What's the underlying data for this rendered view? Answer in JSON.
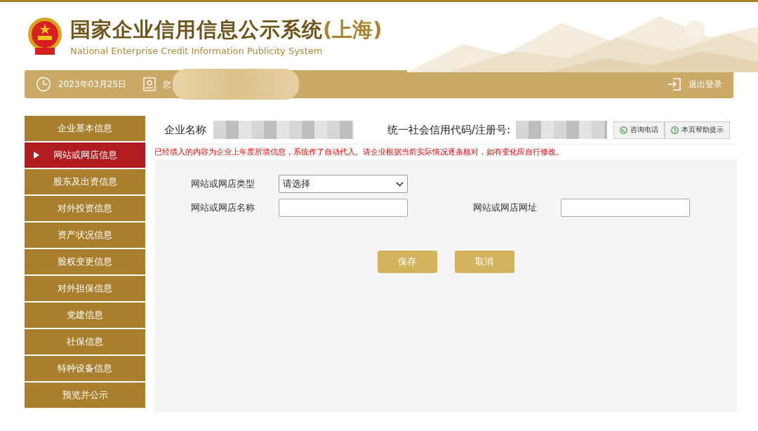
{
  "header": {
    "title": "国家企业信用信息公示系统",
    "region": "(上海)",
    "subtitle": "National Enterprise Credit Information Publicity System"
  },
  "top_bar": {
    "date": "2023年03月25日",
    "greeting": "您",
    "logout": "退出登录"
  },
  "sidebar": {
    "items": [
      {
        "label": "企业基本信息",
        "selected": false
      },
      {
        "label": "网站或网店信息",
        "selected": true
      },
      {
        "label": "股东及出资信息",
        "selected": false
      },
      {
        "label": "对外投资信息",
        "selected": false
      },
      {
        "label": "资产状况信息",
        "selected": false
      },
      {
        "label": "股权变更信息",
        "selected": false
      },
      {
        "label": "对外担保信息",
        "selected": false
      },
      {
        "label": "党建信息",
        "selected": false
      },
      {
        "label": "社保信息",
        "selected": false
      },
      {
        "label": "特种设备信息",
        "selected": false
      },
      {
        "label": "预览并公示",
        "selected": false
      }
    ]
  },
  "company": {
    "name_label": "企业名称",
    "code_label": "统一社会信用代码/注册号:"
  },
  "help_buttons": [
    "咨询电话",
    "本页帮助提示"
  ],
  "notice": "已经填入的内容为企业上年度所填信息，系统作了自动代入。请企业根据当前实际情况逐条核对，如有变化应自行修改。",
  "form": {
    "type_label": "网站或网店类型",
    "type_value": "请选择",
    "name_label": "网站或网店名称",
    "url_label": "网站或网店网址"
  },
  "buttons": [
    "保存",
    "取消"
  ]
}
